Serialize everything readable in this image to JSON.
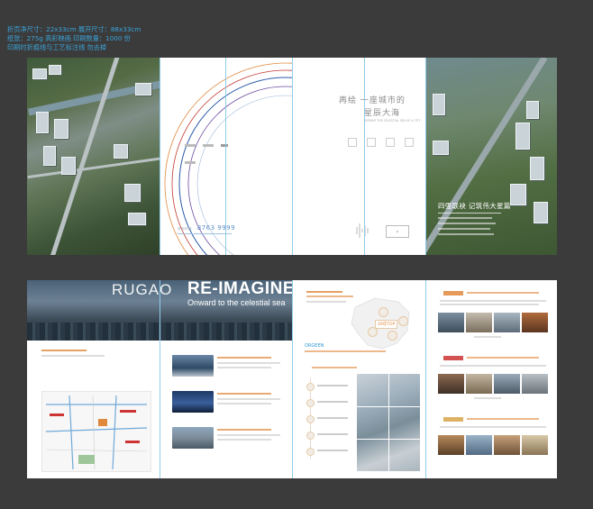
{
  "specs": {
    "line1": "折页净尺寸：22x33cm  展开尺寸：88x33cm",
    "line2": "纸张：275g 高彩映画  印刷数量：1000 份",
    "line3": "印刷时折痕线与工艺标注线 勿去掉"
  },
  "cover": {
    "slogan_line1": "再绘 一座城市的",
    "slogan_line2": "星辰大海",
    "slogan_sub": "REPAINT THE CELESTIAL SEA OF A CITY",
    "hotline": "8763 9999",
    "hotline_label": "咨询热线"
  },
  "back": {
    "tagline": "四强联袂 记筑伟大星篇"
  },
  "banner": {
    "city": "RUGAO",
    "title": "RE-IMAGINE",
    "subtitle": "Onward to the celestial sea"
  },
  "map": {
    "badge": "29年TOP"
  },
  "brand": {
    "mark": "ORGEEN"
  },
  "colors": {
    "accent": "#e0883c",
    "guide": "#8fcbe8",
    "spec_text": "#3aa3d8",
    "background": "#3b3b3b"
  }
}
